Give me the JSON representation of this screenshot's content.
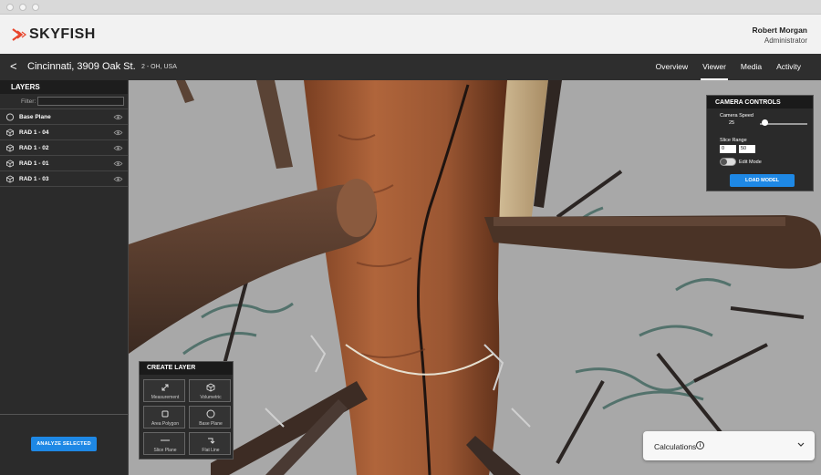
{
  "app": {
    "brand": "SKYFISH"
  },
  "user": {
    "name": "Robert Morgan",
    "role": "Administrator"
  },
  "nav": {
    "back_icon": "chevron-left-icon",
    "title": "Cincinnati, 3909 Oak St.",
    "subtitle": "2 - OH, USA",
    "tabs": [
      {
        "label": "Overview",
        "active": false
      },
      {
        "label": "Viewer",
        "active": true
      },
      {
        "label": "Media",
        "active": false
      },
      {
        "label": "Activity",
        "active": false
      }
    ]
  },
  "layers": {
    "header": "LAYERS",
    "filter_label": "Filter:",
    "filter_value": "",
    "items": [
      {
        "label": "Base Plane",
        "icon": "compass-icon"
      },
      {
        "label": "RAD 1 - 04",
        "icon": "cube-icon"
      },
      {
        "label": "RAD 1 - 02",
        "icon": "cube-icon"
      },
      {
        "label": "RAD 1 - 01",
        "icon": "cube-icon"
      },
      {
        "label": "RAD 1 - 03",
        "icon": "cube-icon"
      }
    ],
    "analyze_label": "ANALYZE SELECTED"
  },
  "camera": {
    "header": "CAMERA CONTROLS",
    "speed_label": "Camera Speed",
    "speed_value": "25",
    "speed_level": 0.1,
    "slice_label": "Slice Range",
    "slice_min": "0",
    "slice_max": "50",
    "edit_mode_label": "Edit Mode",
    "edit_mode_on": false,
    "load_label": "LOAD MODEL"
  },
  "create_layer": {
    "header": "CREATE LAYER",
    "tools": [
      {
        "label": "Measurement",
        "icon": "diagonal-arrows-icon"
      },
      {
        "label": "Volumetric",
        "icon": "cube-icon"
      },
      {
        "label": "Area Polygon",
        "icon": "square-icon"
      },
      {
        "label": "Base Plane",
        "icon": "compass-icon"
      },
      {
        "label": "Slice Plane",
        "icon": "line-icon"
      },
      {
        "label": "Flat Line",
        "icon": "corner-arrow-icon"
      }
    ]
  },
  "calculations": {
    "label": "Calculations",
    "info_glyph": "i"
  },
  "colors": {
    "accent": "#1e88e5",
    "logo": "#e8452c",
    "sidebar": "#2b2b2b",
    "navbar": "#2e2e2e"
  }
}
